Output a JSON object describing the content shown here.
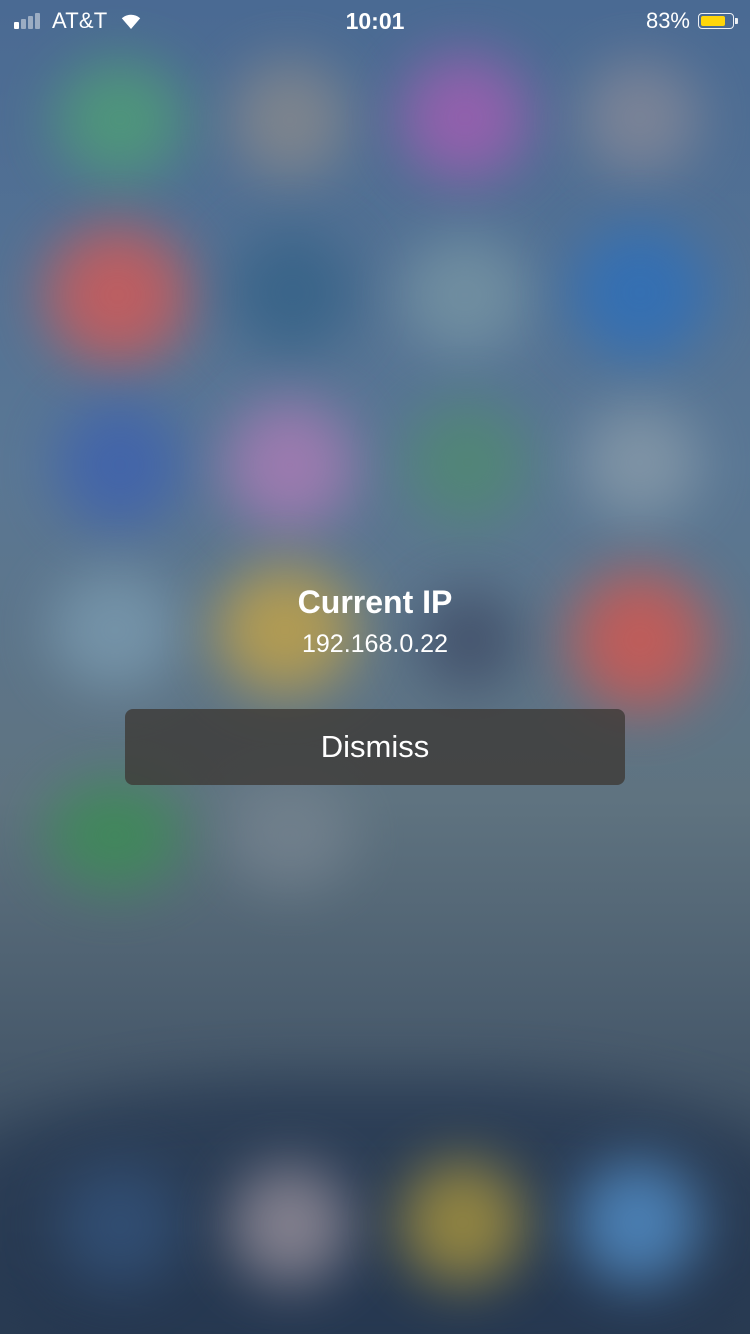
{
  "status_bar": {
    "carrier": "AT&T",
    "time": "10:01",
    "battery_percent_label": "83%",
    "battery_level": 0.83,
    "battery_color": "#ffd60a",
    "signal_bars_active": 1,
    "signal_bars_total": 4,
    "icons": [
      "signal-icon",
      "wifi-icon",
      "battery-icon"
    ]
  },
  "alert": {
    "title": "Current IP",
    "message": "192.168.0.22",
    "dismiss_label": "Dismiss"
  },
  "colors": {
    "text": "#ffffff",
    "button_background": "#3c3834"
  }
}
